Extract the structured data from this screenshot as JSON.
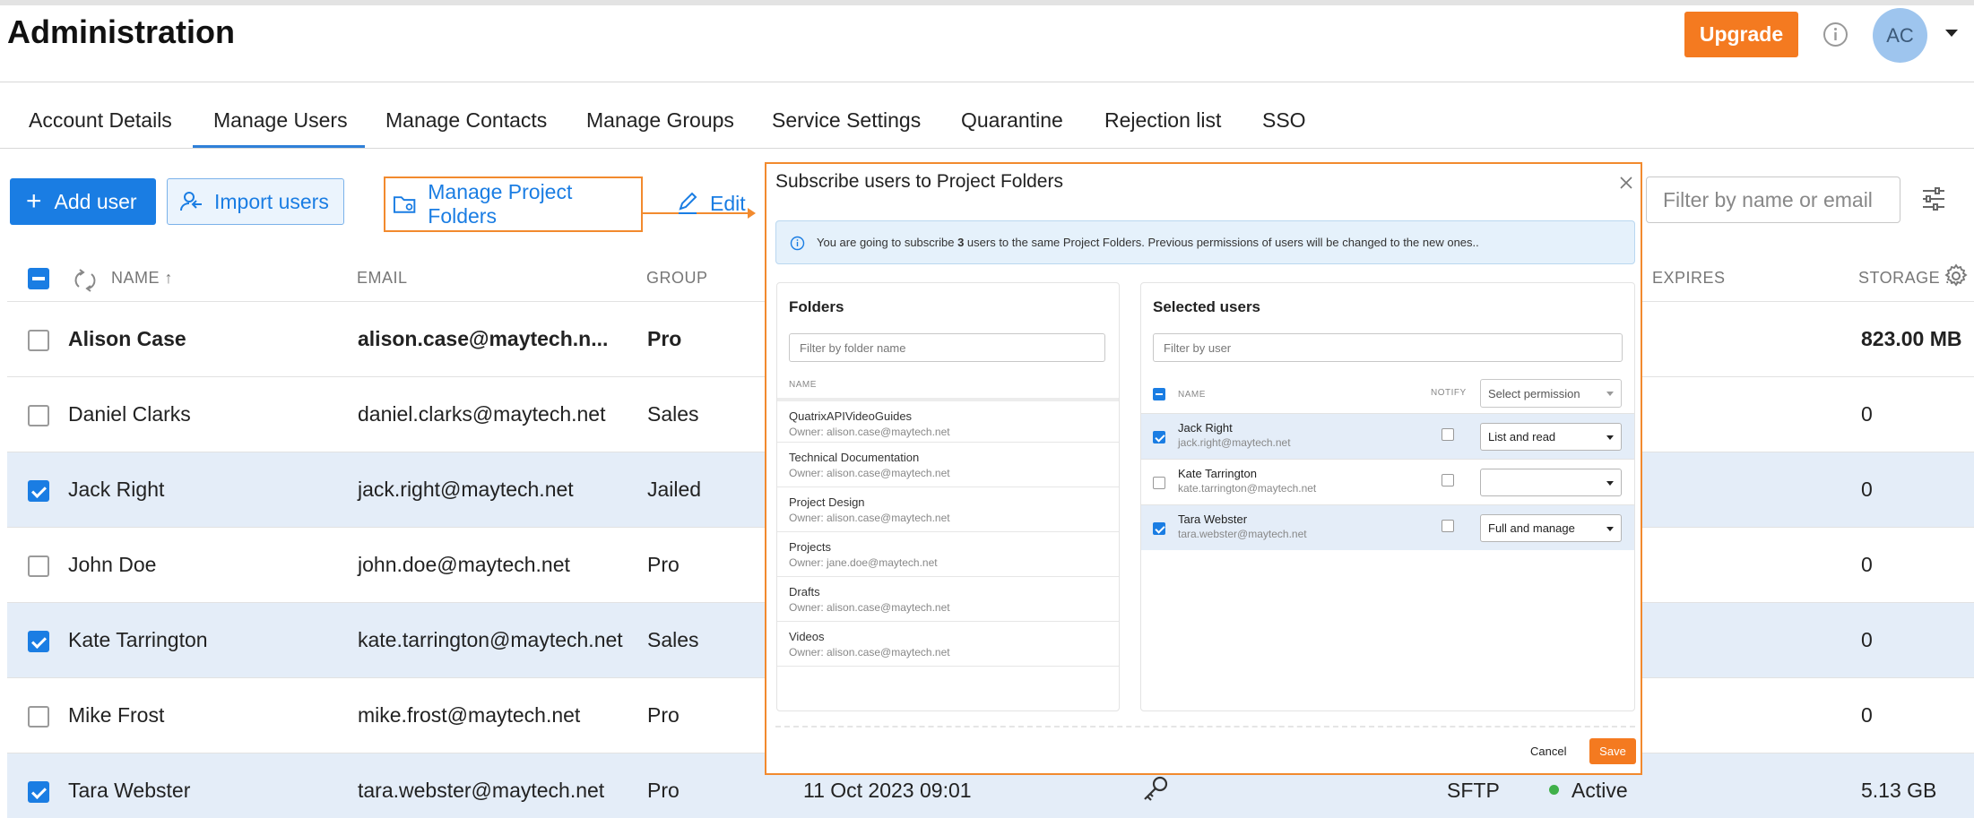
{
  "header": {
    "title": "Administration",
    "upgrade_label": "Upgrade",
    "avatar_initials": "AC"
  },
  "tabs": [
    {
      "label": "Account Details"
    },
    {
      "label": "Manage Users",
      "active": true
    },
    {
      "label": "Manage Contacts"
    },
    {
      "label": "Manage Groups"
    },
    {
      "label": "Service Settings"
    },
    {
      "label": "Quarantine"
    },
    {
      "label": "Rejection list"
    },
    {
      "label": "SSO"
    }
  ],
  "toolbar": {
    "add_user_label": "Add user",
    "import_users_label": "Import users",
    "manage_project_folders_label": "Manage Project Folders",
    "edit_label": "Edit",
    "filter_placeholder": "Filter by name or email"
  },
  "table": {
    "columns": {
      "name": "NAME ↑",
      "email": "EMAIL",
      "group": "GROUP",
      "expires": "EXPIRES",
      "storage": "STORAGE ..."
    },
    "rows": [
      {
        "name": "Alison Case",
        "email": "alison.case@maytech.n...",
        "group": "Pro",
        "storage": "823.00 MB",
        "selected": false,
        "bold": true
      },
      {
        "name": "Daniel Clarks",
        "email": "daniel.clarks@maytech.net",
        "group": "Sales",
        "storage": "0",
        "selected": false
      },
      {
        "name": "Jack Right",
        "email": "jack.right@maytech.net",
        "group": "Jailed",
        "storage": "0",
        "selected": true
      },
      {
        "name": "John Doe",
        "email": "john.doe@maytech.net",
        "group": "Pro",
        "storage": "0",
        "selected": false
      },
      {
        "name": "Kate Tarrington",
        "email": "kate.tarrington@maytech.net",
        "group": "Sales",
        "storage": "0",
        "selected": true
      },
      {
        "name": "Mike Frost",
        "email": "mike.frost@maytech.net",
        "group": "Pro",
        "storage": "0",
        "selected": false
      },
      {
        "name": "Tara Webster",
        "email": "tara.webster@maytech.net",
        "group": "Pro",
        "date": "11 Oct 2023 09:01",
        "type": "SFTP",
        "status": "Active",
        "storage": "5.13 GB",
        "selected": true
      }
    ]
  },
  "modal": {
    "title": "Subscribe users to Project Folders",
    "info_prefix": "You are going to subscribe ",
    "info_count": "3",
    "info_suffix": " users to the same Project Folders. Previous permissions of users will be changed to the new ones..",
    "folders_title": "Folders",
    "folders_search_placeholder": "Filter by folder name",
    "folders_col_name": "NAME",
    "folders": [
      {
        "name": "QuatrixAPIVideoGuides",
        "owner": "Owner: alison.case@maytech.net"
      },
      {
        "name": "Technical Documentation",
        "owner": "Owner: alison.case@maytech.net"
      },
      {
        "name": "Project Design",
        "owner": "Owner: alison.case@maytech.net"
      },
      {
        "name": "Projects",
        "owner": "Owner: jane.doe@maytech.net"
      },
      {
        "name": "Drafts",
        "owner": "Owner: alison.case@maytech.net"
      },
      {
        "name": "Videos",
        "owner": "Owner: alison.case@maytech.net"
      }
    ],
    "users_title": "Selected users",
    "users_search_placeholder": "Filter by user",
    "users_col_name": "NAME",
    "users_col_notify": "NOTIFY",
    "permission_placeholder": "Select permission",
    "users": [
      {
        "name": "Jack Right",
        "email": "jack.right@maytech.net",
        "permission": "List and read",
        "checked": true
      },
      {
        "name": "Kate Tarrington",
        "email": "kate.tarrington@maytech.net",
        "permission": "",
        "checked": false
      },
      {
        "name": "Tara Webster",
        "email": "tara.webster@maytech.net",
        "permission": "Full and manage",
        "checked": true
      }
    ],
    "cancel_label": "Cancel",
    "save_label": "Save"
  },
  "colors": {
    "accent": "#1a7de3",
    "orange": "#f47a20",
    "highlight": "#f28a2e",
    "selected_row": "#e4edf8",
    "active": "#3fb04a"
  }
}
